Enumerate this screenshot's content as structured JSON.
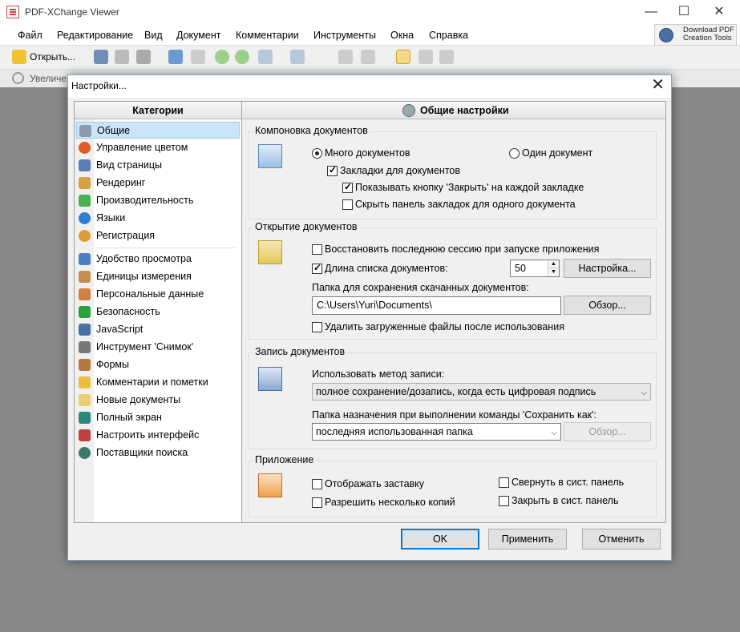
{
  "app": {
    "title": "PDF-XChange Viewer"
  },
  "menu": [
    "Файл",
    "Редактирование",
    "Вид",
    "Документ",
    "Комментарии",
    "Инструменты",
    "Окна",
    "Справка"
  ],
  "promo": {
    "line1": "Download PDF",
    "line2": "Creation Tools"
  },
  "toolbar": {
    "open_label": "Открыть...",
    "zoom_label": "Увеличе"
  },
  "dialog": {
    "title": "Настройки...",
    "categories_header": "Категории",
    "panel_title": "Общие настройки",
    "categories_group1": [
      "Общие",
      "Управление цветом",
      "Вид страницы",
      "Рендеринг",
      "Производительность",
      "Языки",
      "Регистрация"
    ],
    "categories_group2": [
      "Удобство просмотра",
      "Единицы измерения",
      "Персональные данные",
      "Безопасность",
      "JavaScript",
      "Инструмент 'Снимок'",
      "Формы",
      "Комментарии и пометки",
      "Новые документы",
      "Полный экран",
      "Настроить интерфейс",
      "Поставщики поиска"
    ],
    "layout": {
      "title": "Компоновка документов",
      "multi_docs": "Много документов",
      "single_doc": "Один документ",
      "doc_tabs": "Закладки для документов",
      "show_close": "Показывать кнопку 'Закрыть' на каждой закладке",
      "hide_tabbar": "Скрыть панель закладок для одного документа"
    },
    "opening": {
      "title": "Открытие документов",
      "restore_session": "Восстановить последнюю сессию при запуске приложения",
      "list_length": "Длина списка документов:",
      "list_value": "50",
      "settings_btn": "Настройка...",
      "download_folder_label": "Папка для сохранения скачанных документов:",
      "download_folder_value": "C:\\Users\\Yuri\\Documents\\",
      "browse_btn": "Обзор...",
      "delete_downloaded": "Удалить загруженные файлы после использования"
    },
    "saving": {
      "title": "Запись документов",
      "method_label": "Использовать метод записи:",
      "method_value": "полное сохранение/дозапись, когда есть цифровая подпись",
      "saveas_label": "Папка назначения при выполнении команды 'Сохранить как':",
      "saveas_value": "последняя использованная папка",
      "browse_btn": "Обзор..."
    },
    "application": {
      "title": "Приложение",
      "show_splash": "Отображать заставку",
      "allow_multi": "Разрешить несколько копий",
      "minimize_tray": "Свернуть в сист. панель",
      "close_tray": "Закрыть в сист. панель"
    },
    "buttons": {
      "ok": "OK",
      "apply": "Применить",
      "cancel": "Отменить"
    }
  },
  "icon_colors": {
    "accent": "#0078d7",
    "categories": [
      "#8a9bb0",
      "#e05a2a",
      "#5b7fb5",
      "#d9a040",
      "#4caf50",
      "#2f7fd0",
      "#e09a3a",
      "#4a7fc1",
      "#c09050",
      "#d08040",
      "#2e9e3e",
      "#4a6fa5",
      "#777777",
      "#b07a40",
      "#e8c040",
      "#e8d070",
      "#2a8a7a",
      "#c04040",
      "#3a7a6a"
    ]
  }
}
